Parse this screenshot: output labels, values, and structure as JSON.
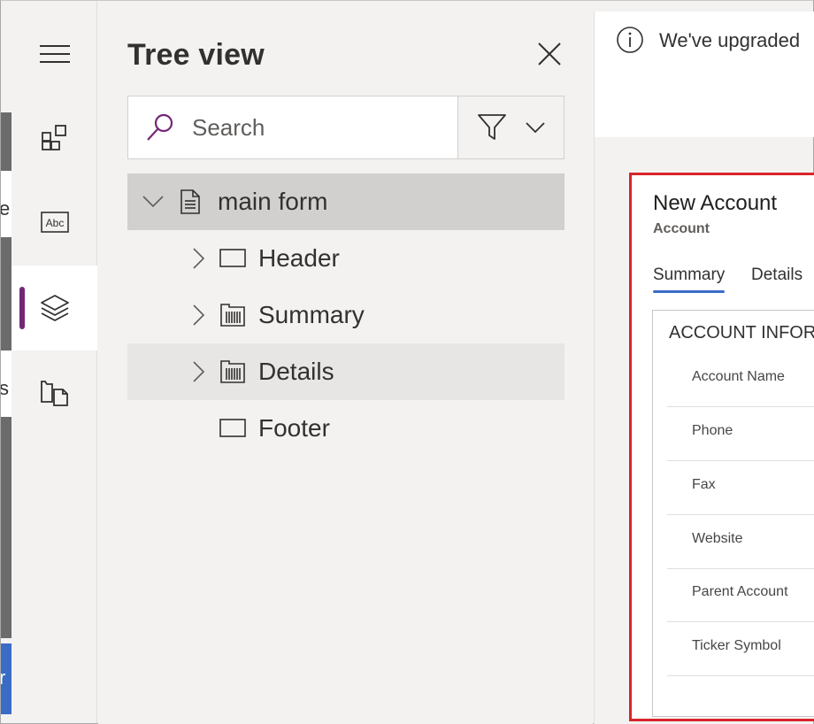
{
  "rail": {
    "items": [
      {
        "name": "components-icon"
      },
      {
        "name": "fields-icon",
        "badge": "Abc"
      },
      {
        "name": "tree-view-icon"
      },
      {
        "name": "form-libraries-icon"
      }
    ]
  },
  "tree_view": {
    "title": "Tree view",
    "search": {
      "placeholder": "Search"
    },
    "nodes": [
      {
        "label": "main form",
        "icon": "form-document-icon",
        "level": 0
      },
      {
        "label": "Header",
        "icon": "rectangle-icon",
        "level": 1
      },
      {
        "label": "Summary",
        "icon": "tab-columns-icon",
        "level": 1
      },
      {
        "label": "Details",
        "icon": "tab-columns-icon",
        "level": 1
      },
      {
        "label": "Footer",
        "icon": "rectangle-icon",
        "level": 1
      }
    ]
  },
  "notice": {
    "text": "We've upgraded"
  },
  "form_preview": {
    "title": "New Account",
    "subtitle": "Account",
    "tabs": [
      "Summary",
      "Details"
    ],
    "section_title": "ACCOUNT INFOR",
    "fields": [
      "Account Name",
      "Phone",
      "Fax",
      "Website",
      "Parent Account",
      "Ticker Symbol"
    ]
  },
  "colors": {
    "accent": "#742774",
    "highlight_border": "#d9242b",
    "tab_underline": "#3a6cc6"
  }
}
